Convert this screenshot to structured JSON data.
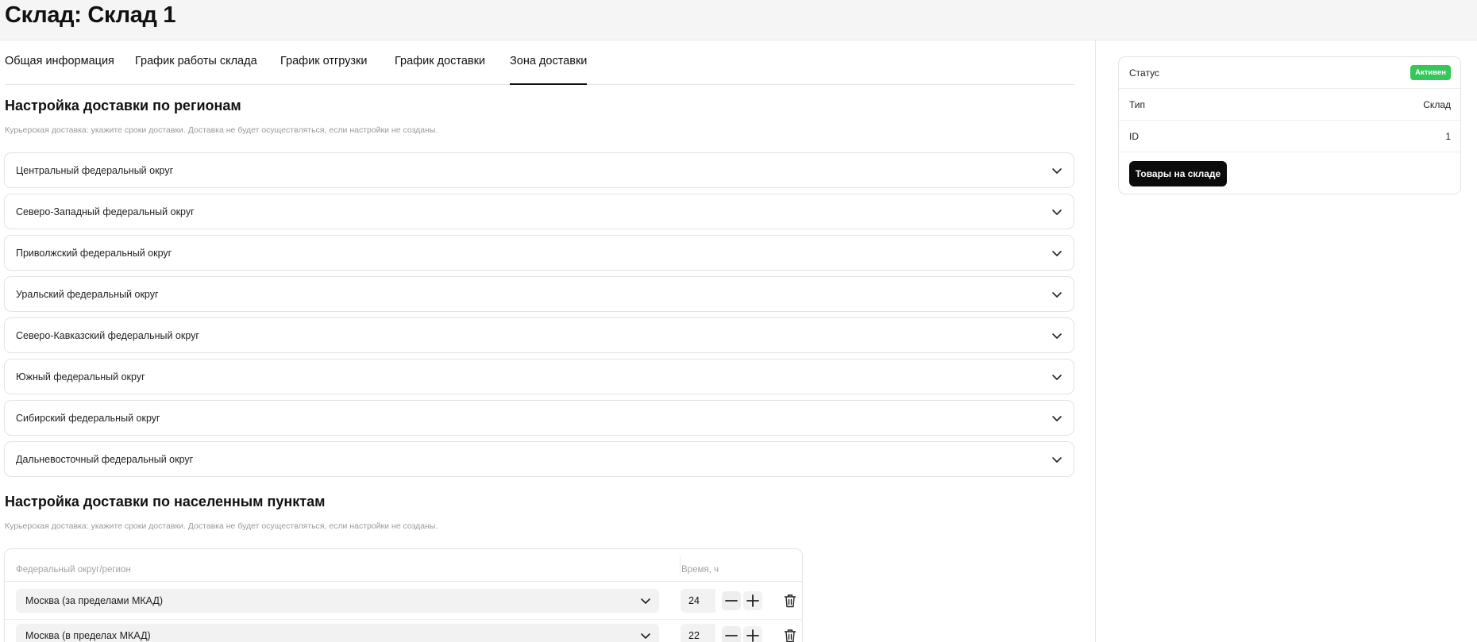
{
  "page": {
    "title": "Склад: Склад 1"
  },
  "tabs": [
    {
      "label": "Общая информация"
    },
    {
      "label": "График работы склада"
    },
    {
      "label": "График отгрузки"
    },
    {
      "label": "График доставки"
    },
    {
      "label": "Зона доставки",
      "active": true
    }
  ],
  "regions_section": {
    "title": "Настройка доставки по регионам",
    "hint": "Курьерская доставка: укажите сроки доставки. Доставка не будет осуществляться, если настройки не созданы.",
    "items": [
      {
        "label": "Центральный федеральный округ"
      },
      {
        "label": "Северо-Западный федеральный округ"
      },
      {
        "label": "Приволжский федеральный округ"
      },
      {
        "label": "Уральский федеральный округ"
      },
      {
        "label": "Северо-Кавказский федеральный округ"
      },
      {
        "label": "Южный федеральный округ"
      },
      {
        "label": "Сибирский федеральный округ"
      },
      {
        "label": "Дальневосточный федеральный округ"
      }
    ]
  },
  "cities_section": {
    "title": "Настройка доставки по населенным пунктам",
    "hint": "Курьерская доставка: укажите сроки доставки. Доставка не будет осуществляться, если настройки не созданы.",
    "columns": {
      "region": "Федеральный округ/регион",
      "time": "Время, ч"
    },
    "rows": [
      {
        "region": "Москва (за пределами МКАД)",
        "hours": "24"
      },
      {
        "region": "Москва (в пределах МКАД)",
        "hours": "22"
      }
    ]
  },
  "side_card": {
    "status_label": "Статус",
    "status_value": "Активен",
    "type_label": "Тип",
    "type_value": "Склад",
    "id_label": "ID",
    "id_value": "1",
    "goods_button": "Товары на складе"
  },
  "colors": {
    "status_active": "#34c759",
    "primary_button": "#0b0b0b",
    "page_header_bg": "#f5f5f5"
  },
  "icons": {
    "expand": "chevron-down-icon",
    "decrement": "minus-icon",
    "increment": "plus-icon",
    "delete": "trash-icon"
  }
}
